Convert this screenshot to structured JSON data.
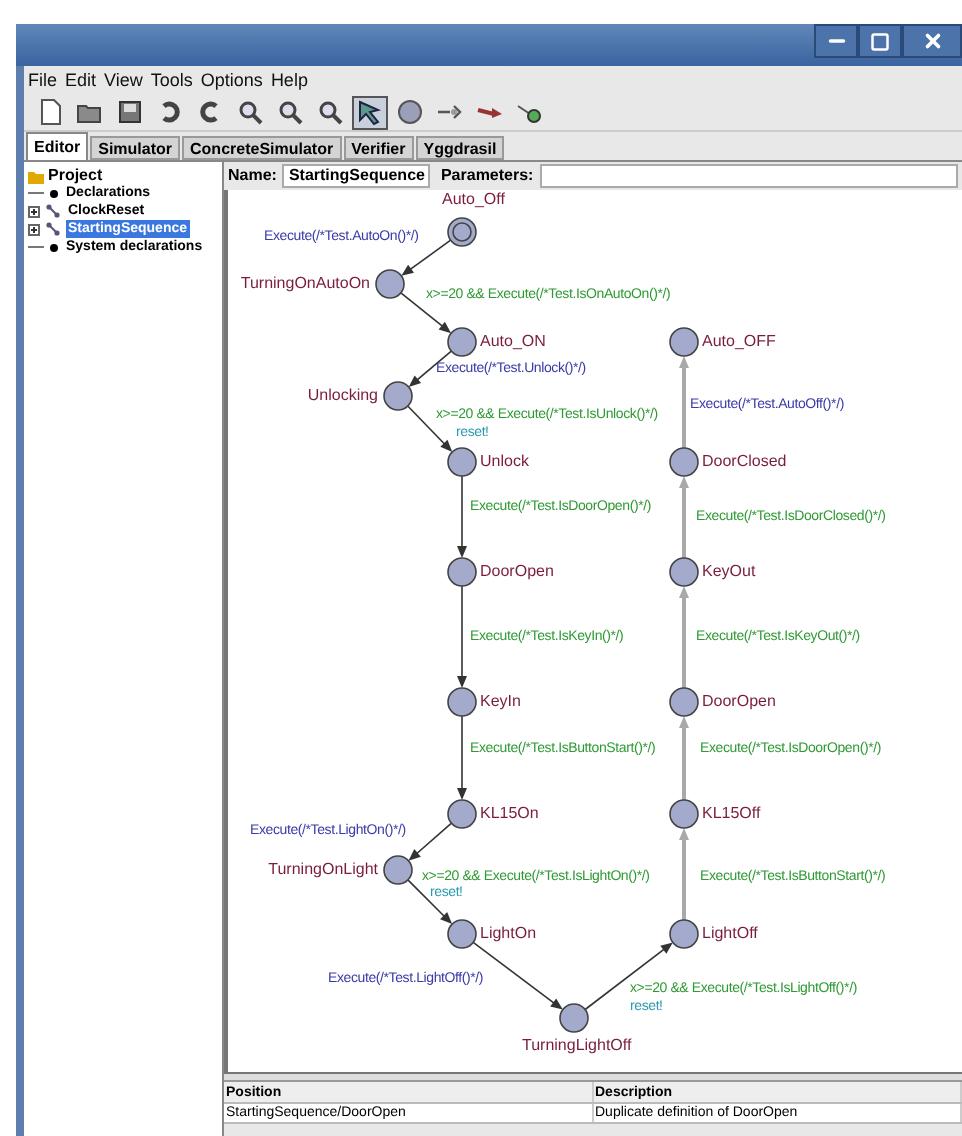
{
  "menu": [
    "File",
    "Edit",
    "View",
    "Tools",
    "Options",
    "Help"
  ],
  "toolbar": [
    {
      "kind": "new",
      "selected": false
    },
    {
      "kind": "open",
      "selected": false
    },
    {
      "kind": "save",
      "selected": false
    },
    {
      "kind": "undo",
      "selected": false
    },
    {
      "kind": "redo",
      "selected": false
    },
    {
      "kind": "zoom-fit",
      "selected": false
    },
    {
      "kind": "zoom-in",
      "selected": false
    },
    {
      "kind": "zoom-out",
      "selected": false
    },
    {
      "kind": "select",
      "selected": true
    },
    {
      "kind": "location",
      "selected": false
    },
    {
      "kind": "nail",
      "selected": false
    },
    {
      "kind": "edge",
      "selected": false
    },
    {
      "kind": "branch",
      "selected": false
    }
  ],
  "tabs": [
    {
      "label": "Editor",
      "selected": true
    },
    {
      "label": "Simulator",
      "selected": false
    },
    {
      "label": "ConcreteSimulator",
      "selected": false
    },
    {
      "label": "Verifier",
      "selected": false
    },
    {
      "label": "Yggdrasil",
      "selected": false
    }
  ],
  "tree": {
    "label": "Project",
    "children": [
      {
        "label": "Declarations",
        "kind": "declarations",
        "selected": false
      },
      {
        "label": "ClockReset",
        "kind": "template",
        "selected": false
      },
      {
        "label": "StartingSequence",
        "kind": "template",
        "selected": true
      },
      {
        "label": "System declarations",
        "kind": "declarations",
        "selected": false
      }
    ]
  },
  "template": {
    "name_label": "Name:",
    "name": "StartingSequence",
    "parameters_label": "Parameters:"
  },
  "locations": [
    {
      "name": "Auto_Off",
      "initial": true
    },
    {
      "name": "TurningOnAutoOn",
      "initial": false
    },
    {
      "name": "Auto_ON",
      "initial": false
    },
    {
      "name": "Auto_OFF",
      "initial": false
    },
    {
      "name": "Unlocking",
      "initial": false
    },
    {
      "name": "Unlock",
      "initial": false
    },
    {
      "name": "DoorClosed",
      "initial": false
    },
    {
      "name": "DoorOpen",
      "initial": false
    },
    {
      "name": "KeyOut",
      "initial": false
    },
    {
      "name": "KeyIn",
      "initial": false
    },
    {
      "name": "DoorOpen",
      "initial": false
    },
    {
      "name": "KL15On",
      "initial": false
    },
    {
      "name": "KL15Off",
      "initial": false
    },
    {
      "name": "TurningOnLight",
      "initial": false
    },
    {
      "name": "LightOn",
      "initial": false
    },
    {
      "name": "LightOff",
      "initial": false
    },
    {
      "name": "TurningLightOff",
      "initial": false
    }
  ],
  "edges": [
    {
      "selected": false,
      "labels": [
        {
          "kind": "update",
          "text": "Execute(/*Test.AutoOn()*/)"
        }
      ]
    },
    {
      "selected": false,
      "labels": [
        {
          "kind": "guard",
          "text": "x>=20 && Execute(/*Test.IsOnAutoOn()*/)"
        }
      ]
    },
    {
      "selected": false,
      "labels": [
        {
          "kind": "update",
          "text": "Execute(/*Test.Unlock()*/)"
        }
      ]
    },
    {
      "selected": true,
      "labels": [
        {
          "kind": "update",
          "text": "Execute(/*Test.AutoOff()*/)"
        }
      ]
    },
    {
      "selected": false,
      "labels": [
        {
          "kind": "guard",
          "text": "x>=20 && Execute(/*Test.IsUnlock()*/)"
        },
        {
          "kind": "sync",
          "text": "reset!"
        }
      ]
    },
    {
      "selected": false,
      "labels": [
        {
          "kind": "guard",
          "text": "Execute(/*Test.IsDoorOpen()*/)"
        }
      ]
    },
    {
      "selected": true,
      "labels": [
        {
          "kind": "guard",
          "text": "Execute(/*Test.IsDoorClosed()*/)"
        }
      ]
    },
    {
      "selected": false,
      "labels": [
        {
          "kind": "guard",
          "text": "Execute(/*Test.IsKeyIn()*/)"
        }
      ]
    },
    {
      "selected": true,
      "labels": [
        {
          "kind": "guard",
          "text": "Execute(/*Test.IsKeyOut()*/)"
        }
      ]
    },
    {
      "selected": false,
      "labels": [
        {
          "kind": "guard",
          "text": "Execute(/*Test.IsButtonStart()*/)"
        }
      ]
    },
    {
      "selected": true,
      "labels": [
        {
          "kind": "guard",
          "text": "Execute(/*Test.IsDoorOpen()*/)"
        }
      ]
    },
    {
      "selected": false,
      "labels": [
        {
          "kind": "update",
          "text": "Execute(/*Test.LightOn()*/)"
        }
      ]
    },
    {
      "selected": false,
      "labels": [
        {
          "kind": "guard",
          "text": "x>=20 && Execute(/*Test.IsLightOn()*/)"
        },
        {
          "kind": "sync",
          "text": "reset!"
        }
      ]
    },
    {
      "selected": true,
      "labels": [
        {
          "kind": "guard",
          "text": "Execute(/*Test.IsButtonStart()*/)"
        }
      ]
    },
    {
      "selected": false,
      "labels": [
        {
          "kind": "update",
          "text": "Execute(/*Test.LightOff()*/)"
        }
      ]
    },
    {
      "selected": false,
      "labels": [
        {
          "kind": "guard",
          "text": "x>=20 && Execute(/*Test.IsLightOff()*/)"
        },
        {
          "kind": "sync",
          "text": "reset!"
        }
      ]
    }
  ],
  "problems": {
    "columns": [
      "Position",
      "Description"
    ],
    "rows": [
      [
        "StartingSequence/DoorOpen",
        "Duplicate definition of DoorOpen"
      ]
    ]
  }
}
